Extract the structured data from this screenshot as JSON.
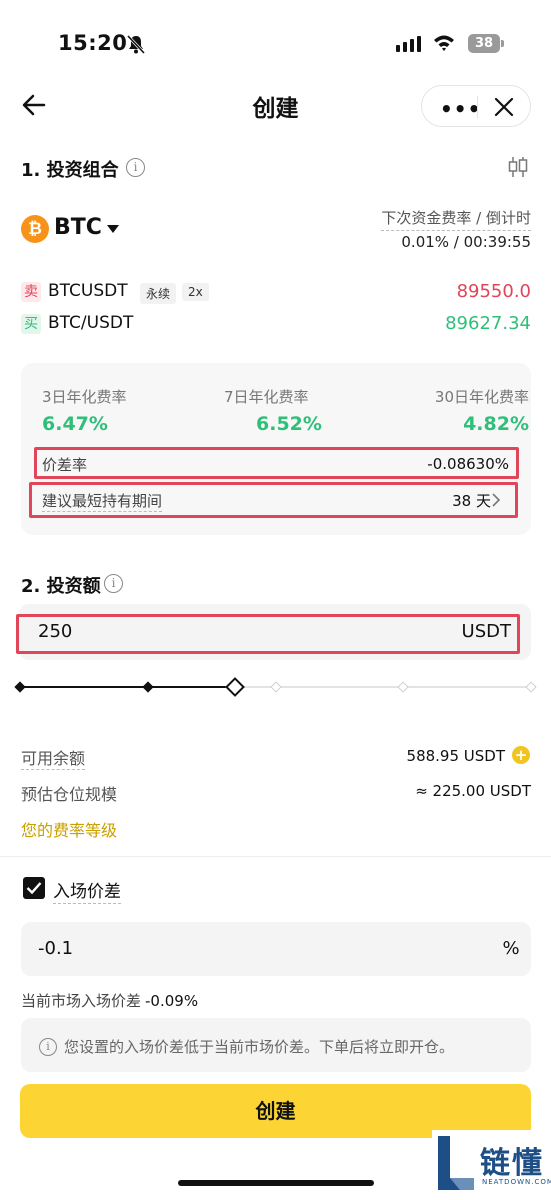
{
  "status_bar": {
    "time": "15:20",
    "battery": "38"
  },
  "header": {
    "title": "创建",
    "more": "•••"
  },
  "section1": {
    "title": "1. 投资组合",
    "asset": "BTC",
    "next_rate_label": "下次资金费率 / 倒计时",
    "next_rate_value": "0.01% / 00:39:55",
    "sell_tag": "卖",
    "sell_pair": "BTCUSDT",
    "sell_chip1": "永续",
    "sell_chip2": "2x",
    "sell_price": "89550.0",
    "buy_tag": "买",
    "buy_pair": "BTC/USDT",
    "buy_price": "89627.34"
  },
  "rates": [
    {
      "label": "3日年化费率",
      "value": "6.47%"
    },
    {
      "label": "7日年化费率",
      "value": "6.52%"
    },
    {
      "label": "30日年化费率",
      "value": "4.82%"
    }
  ],
  "spread_rate": {
    "label": "价差率",
    "value": "-0.08630%"
  },
  "hold_period": {
    "label": "建议最短持有期间",
    "value": "38 天"
  },
  "section2": {
    "title": "2. 投资额",
    "amount": "250",
    "unit": "USDT",
    "slider_percent": 50
  },
  "balance": {
    "label": "可用余额",
    "value": "588.95 USDT"
  },
  "position": {
    "label": "预估仓位规模",
    "value": "≈ 225.00 USDT"
  },
  "fee_level": "您的费率等级",
  "entry_spread": {
    "label": "入场价差",
    "checked": true,
    "value": "-0.1",
    "unit": "%",
    "market_label": "当前市场入场价差",
    "market_value": "-0.09%",
    "notice": "您设置的入场价差低于当前市场价差。下单后将立即开仓。"
  },
  "create_button": "创建",
  "watermark": {
    "text": "链懂",
    "sub": "NEATDOWN.COM"
  },
  "colors": {
    "accent": "#fcd535",
    "up": "#2fbf79",
    "down": "#e0455a",
    "highlight_box": "#e0455a"
  }
}
